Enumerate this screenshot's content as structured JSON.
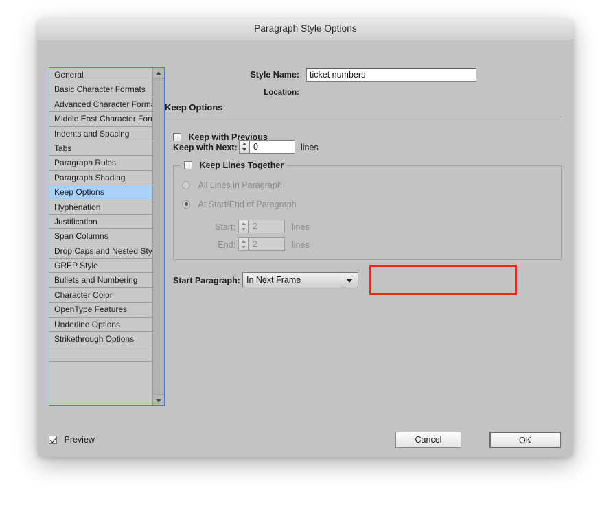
{
  "window": {
    "title": "Paragraph Style Options"
  },
  "sidebar": {
    "items": [
      {
        "label": "General",
        "selected": false
      },
      {
        "label": "Basic Character Formats",
        "selected": false
      },
      {
        "label": "Advanced Character Formats",
        "selected": false
      },
      {
        "label": "Middle East Character Formats",
        "selected": false
      },
      {
        "label": "Indents and Spacing",
        "selected": false
      },
      {
        "label": "Tabs",
        "selected": false
      },
      {
        "label": "Paragraph Rules",
        "selected": false
      },
      {
        "label": "Paragraph Shading",
        "selected": false
      },
      {
        "label": "Keep Options",
        "selected": true
      },
      {
        "label": "Hyphenation",
        "selected": false
      },
      {
        "label": "Justification",
        "selected": false
      },
      {
        "label": "Span Columns",
        "selected": false
      },
      {
        "label": "Drop Caps and Nested Styles",
        "selected": false
      },
      {
        "label": "GREP Style",
        "selected": false
      },
      {
        "label": "Bullets and Numbering",
        "selected": false
      },
      {
        "label": "Character Color",
        "selected": false
      },
      {
        "label": "OpenType Features",
        "selected": false
      },
      {
        "label": "Underline Options",
        "selected": false
      },
      {
        "label": "Strikethrough Options",
        "selected": false
      }
    ],
    "scroll_up_icon": "triangle-up-icon",
    "scroll_down_icon": "triangle-down-icon",
    "selected_color": "#a8d0f8",
    "focus_border_color": "#4a7ec4"
  },
  "style_name": {
    "label": "Style Name:",
    "value": "ticket numbers"
  },
  "location": {
    "label": "Location:",
    "value": ""
  },
  "keep_options": {
    "heading": "Keep Options",
    "keep_with_previous": {
      "label": "Keep with Previous",
      "checked": false
    },
    "keep_with_next": {
      "label": "Keep with Next:",
      "value": "0",
      "unit": "lines",
      "stepper_up_icon": "stepper-up-icon",
      "stepper_down_icon": "stepper-down-icon"
    },
    "keep_lines_together": {
      "label": "Keep Lines Together",
      "checked": false,
      "enabled": false,
      "radio_all_lines": {
        "label": "All Lines in Paragraph",
        "selected": false
      },
      "radio_start_end": {
        "label": "At Start/End of Paragraph",
        "selected": true
      },
      "start": {
        "label": "Start:",
        "value": "2",
        "unit": "lines"
      },
      "end": {
        "label": "End:",
        "value": "2",
        "unit": "lines"
      }
    },
    "start_paragraph": {
      "label": "Start Paragraph:",
      "value": "In Next Frame",
      "dropdown_icon": "chevron-down-icon",
      "highlight_color": "#ee2b16"
    }
  },
  "footer": {
    "preview": {
      "label": "Preview",
      "checked": true
    },
    "cancel_label": "Cancel",
    "ok_label": "OK"
  }
}
